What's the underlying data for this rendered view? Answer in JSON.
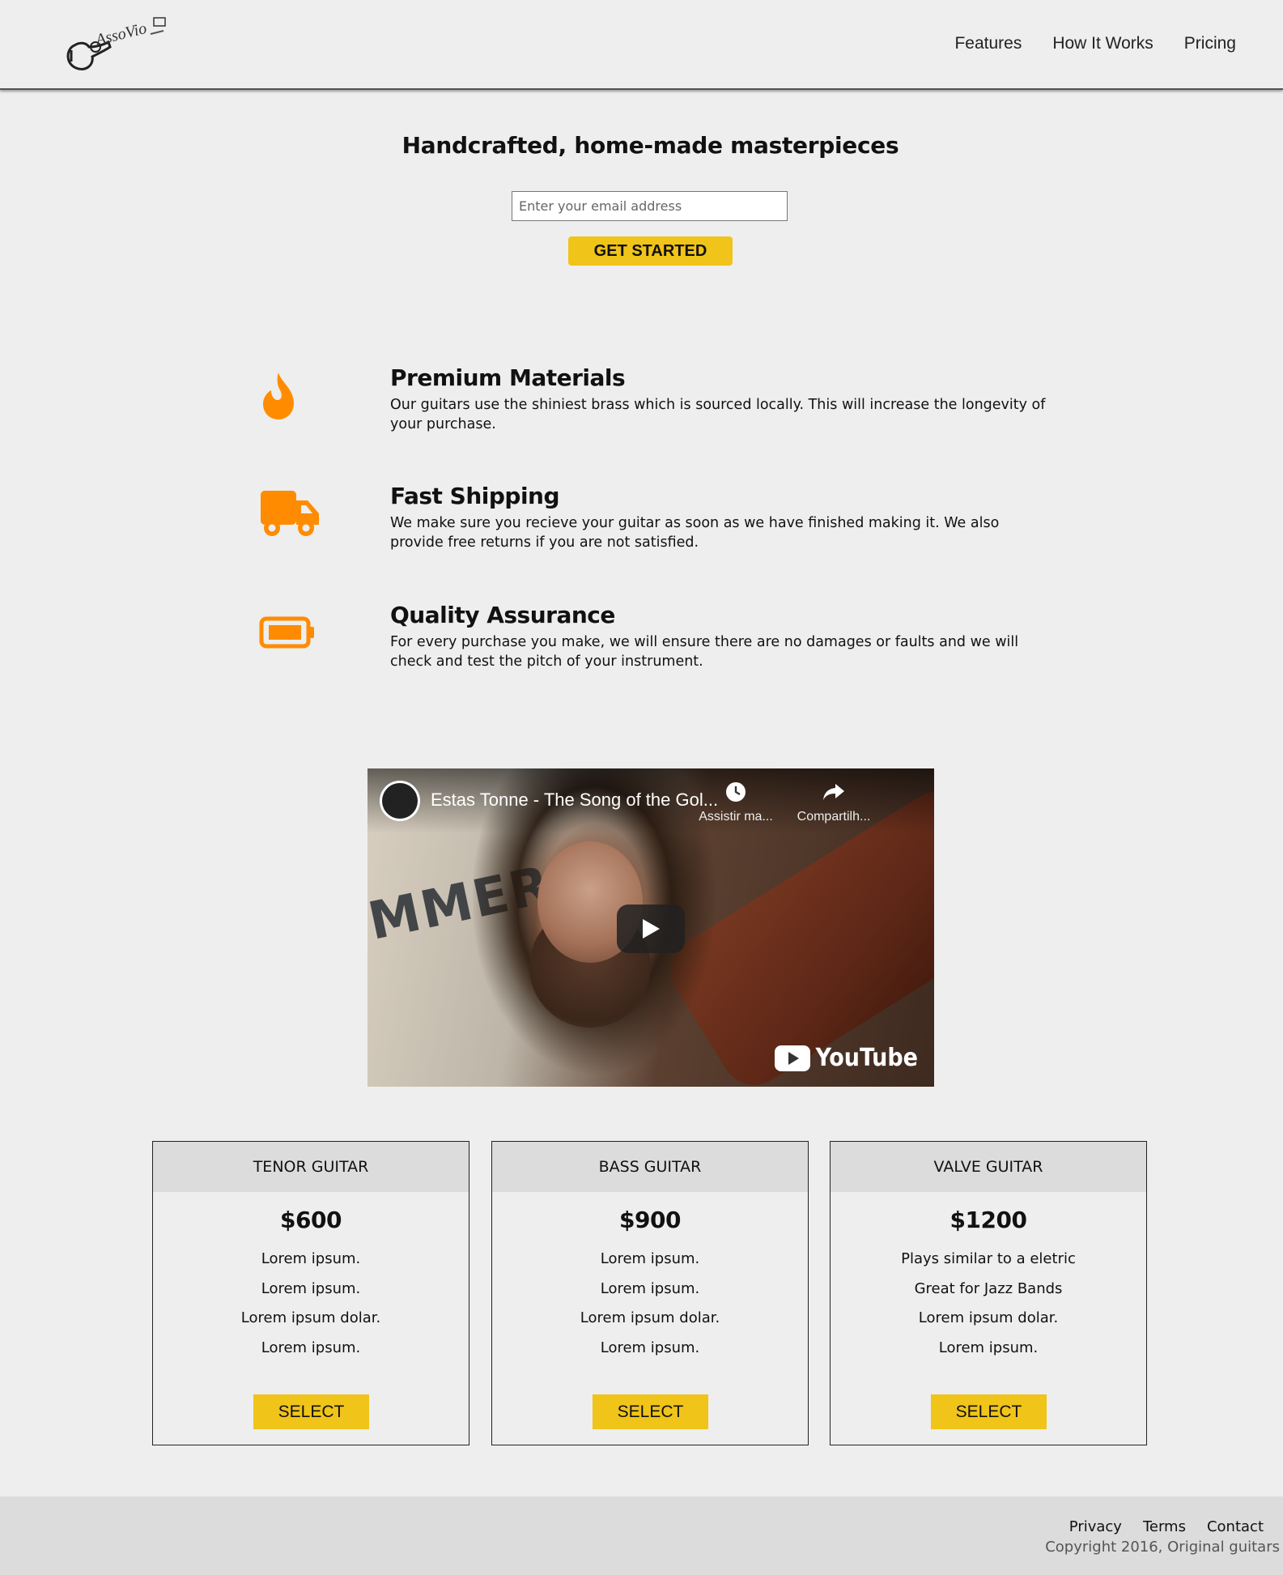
{
  "header": {
    "logo_text": "AssoVio",
    "nav": [
      {
        "label": "Features"
      },
      {
        "label": "How It Works"
      },
      {
        "label": "Pricing"
      }
    ]
  },
  "hero": {
    "title": "Handcrafted, home-made masterpieces",
    "email_placeholder": "Enter your email address",
    "cta_label": "GET STARTED"
  },
  "features": [
    {
      "icon": "fire-icon",
      "title": "Premium Materials",
      "text": "Our guitars use the shiniest brass which is sourced locally. This will increase the longevity of your purchase."
    },
    {
      "icon": "truck-icon",
      "title": "Fast Shipping",
      "text": "We make sure you recieve your guitar as soon as we have finished making it. We also provide free returns if you are not satisfied."
    },
    {
      "icon": "battery-icon",
      "title": "Quality Assurance",
      "text": "For every purchase you make, we will ensure there are no damages or faults and we will check and test the pitch of your instrument."
    }
  ],
  "video": {
    "title": "Estas Tonne - The Song of the Gol...",
    "watch_later": "Assistir ma...",
    "share": "Compartilh...",
    "brand": "YouTube"
  },
  "pricing": [
    {
      "name": "TENOR GUITAR",
      "price": "$600",
      "features": [
        "Lorem ipsum.",
        "Lorem ipsum.",
        "Lorem ipsum dolar.",
        "Lorem ipsum."
      ],
      "button": "SELECT"
    },
    {
      "name": "BASS GUITAR",
      "price": "$900",
      "features": [
        "Lorem ipsum.",
        "Lorem ipsum.",
        "Lorem ipsum dolar.",
        "Lorem ipsum."
      ],
      "button": "SELECT"
    },
    {
      "name": "VALVE GUITAR",
      "price": "$1200",
      "features": [
        "Plays similar to a eletric",
        "Great for Jazz Bands",
        "Lorem ipsum dolar.",
        "Lorem ipsum."
      ],
      "button": "SELECT"
    }
  ],
  "footer": {
    "links": [
      {
        "label": "Privacy"
      },
      {
        "label": "Terms"
      },
      {
        "label": "Contact"
      }
    ],
    "copyright": "Copyright 2016, Original guitars"
  },
  "colors": {
    "accent": "#f0c419",
    "icon": "#ff8c00",
    "background": "#eeeeee"
  }
}
